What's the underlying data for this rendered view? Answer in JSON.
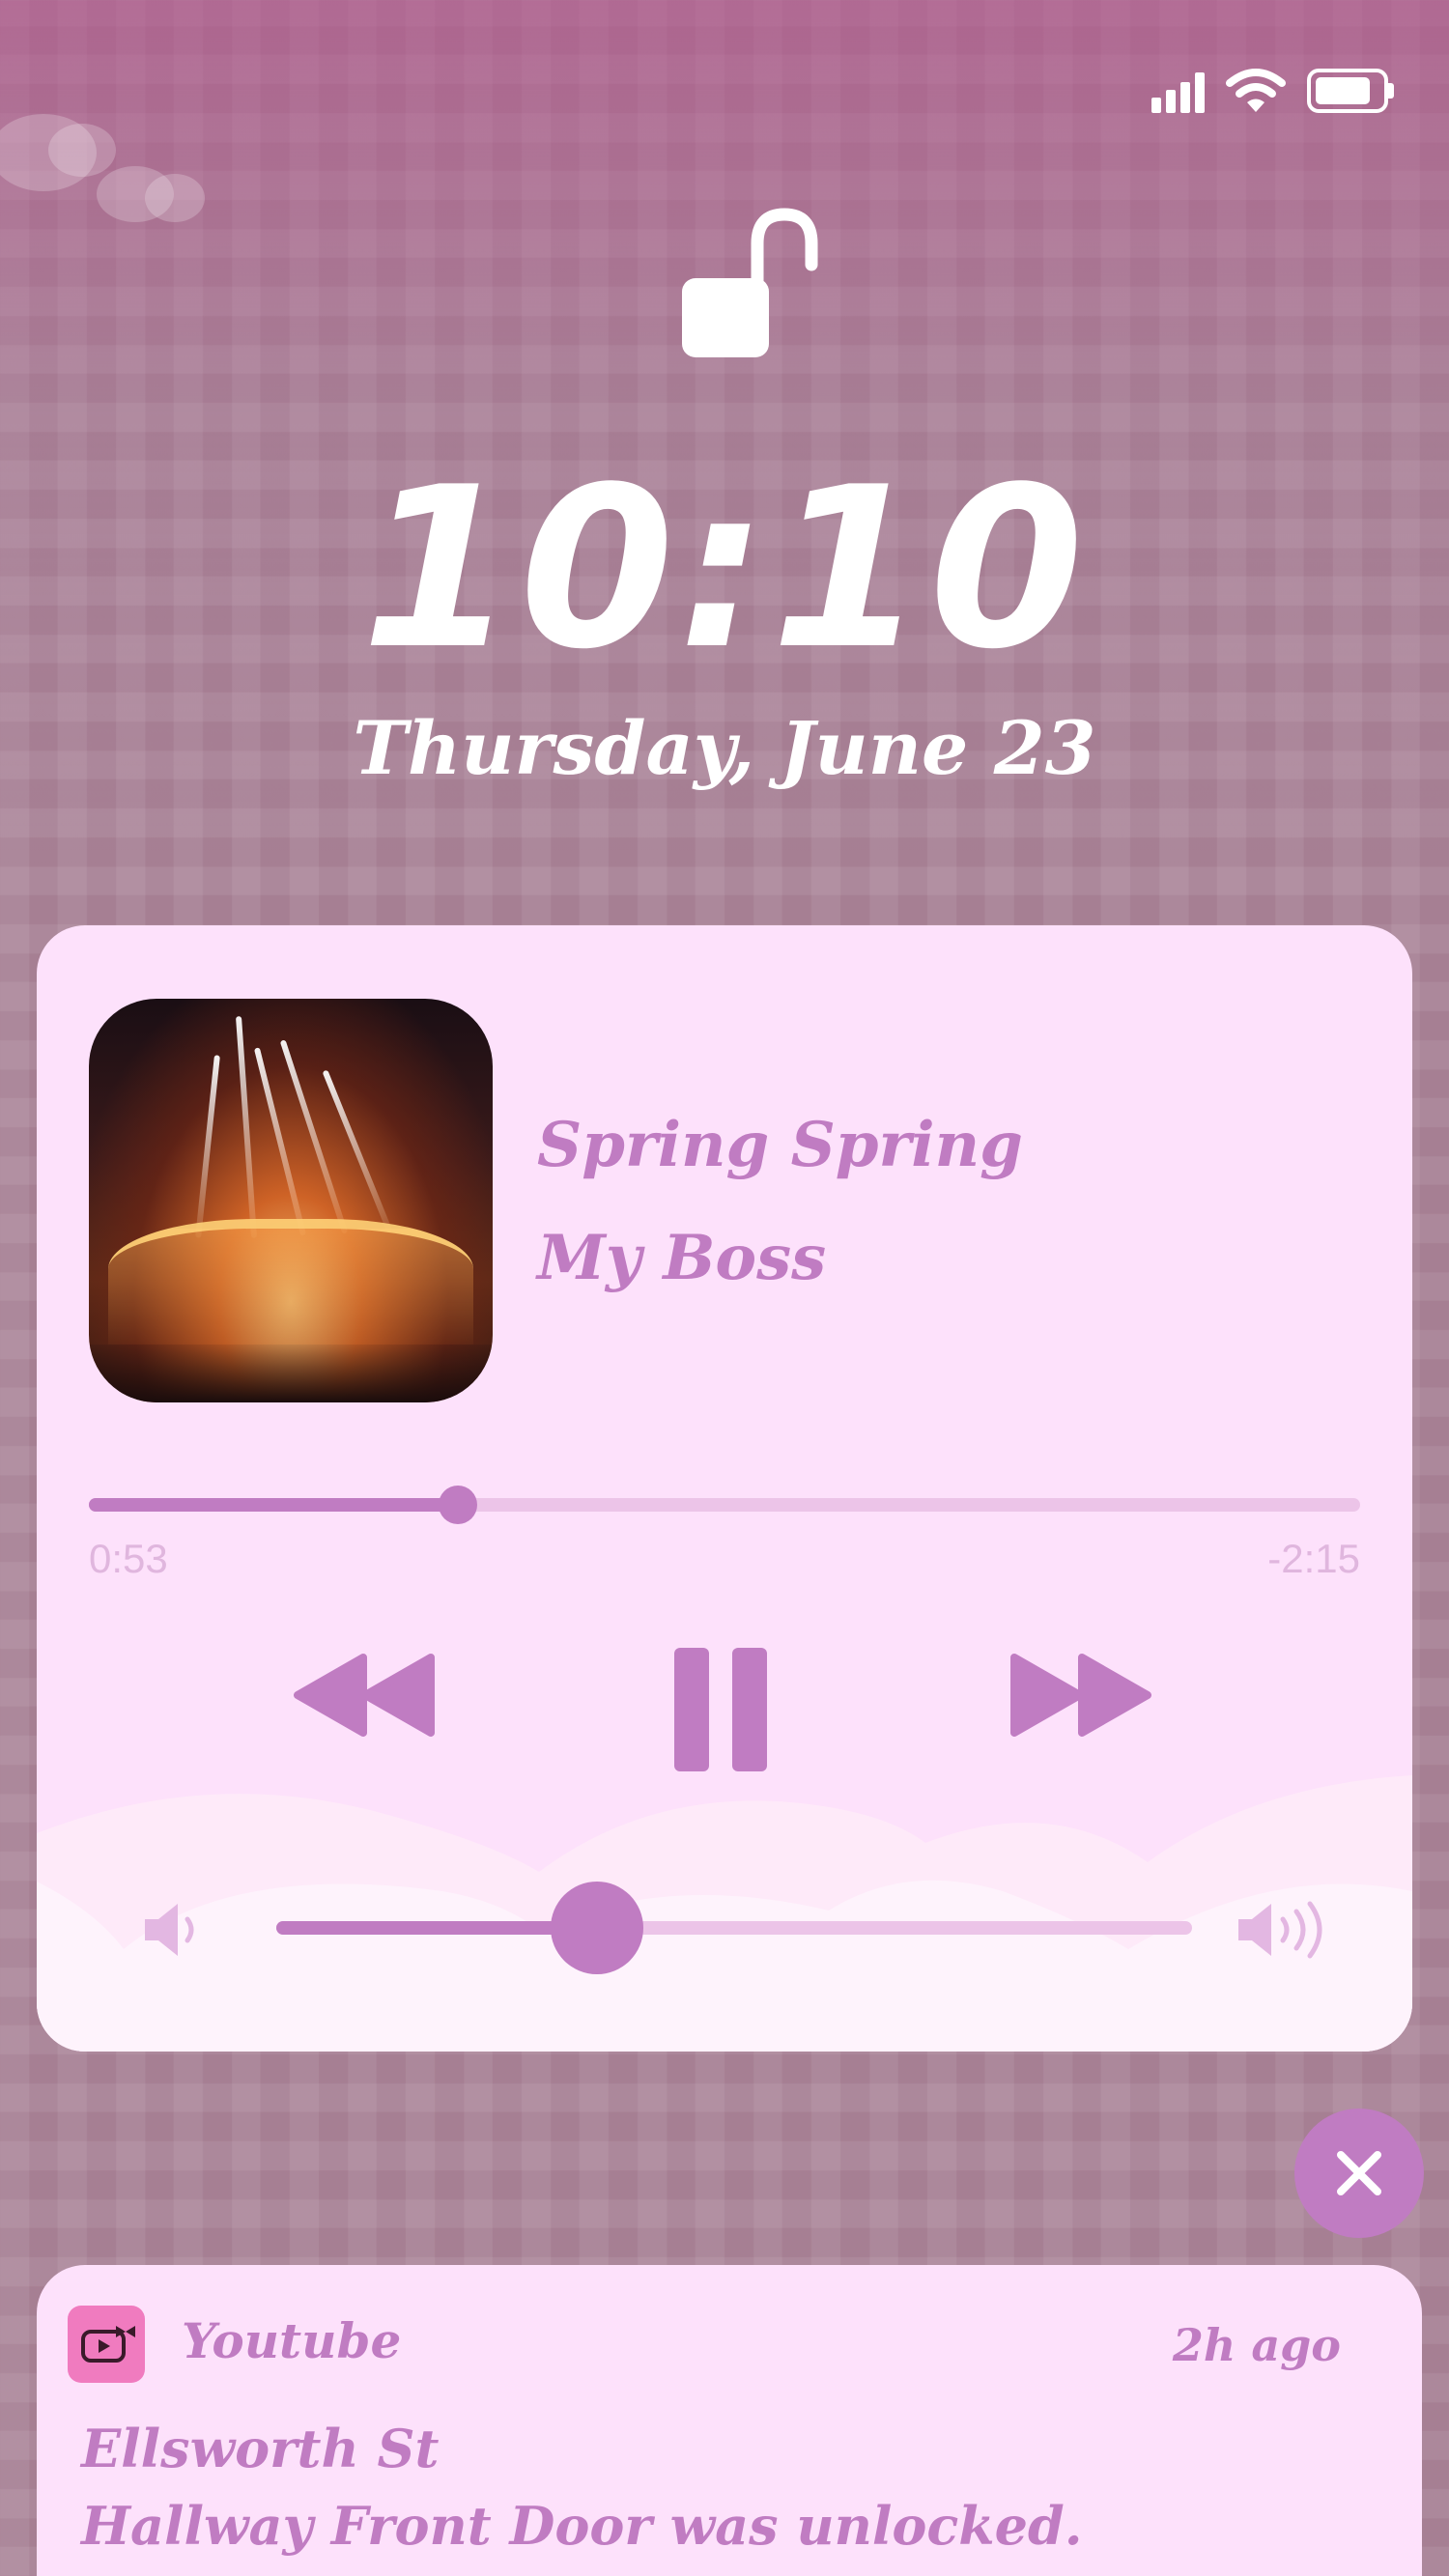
{
  "status_bar": {
    "signal_icon": "cellular-signal-icon",
    "wifi_icon": "wifi-icon",
    "battery_icon": "battery-icon",
    "battery_level": 0.85
  },
  "lock_screen": {
    "lock_icon": "unlocked-padlock-icon",
    "time": "10:10",
    "date": "Thursday, June 23"
  },
  "now_playing": {
    "track_title": "Spring Spring",
    "artist": "My Boss",
    "elapsed": "0:53",
    "remaining": "-2:15",
    "progress": 0.29,
    "volume": 0.35,
    "controls": {
      "previous_icon": "rewind-icon",
      "pause_icon": "pause-icon",
      "next_icon": "fast-forward-icon",
      "volume_min_icon": "speaker-low-icon",
      "volume_max_icon": "speaker-high-icon"
    },
    "colors": {
      "card": "#fde1fb",
      "accent": "#c07cc2",
      "track": "#ecc4e8"
    }
  },
  "dismiss": {
    "icon": "close-icon"
  },
  "notification": {
    "app_name": "Youtube",
    "app_icon": "youtube-play-icon",
    "time": "2h ago",
    "title": "Ellsworth St",
    "body": "Hallway Front Door was unlocked."
  }
}
